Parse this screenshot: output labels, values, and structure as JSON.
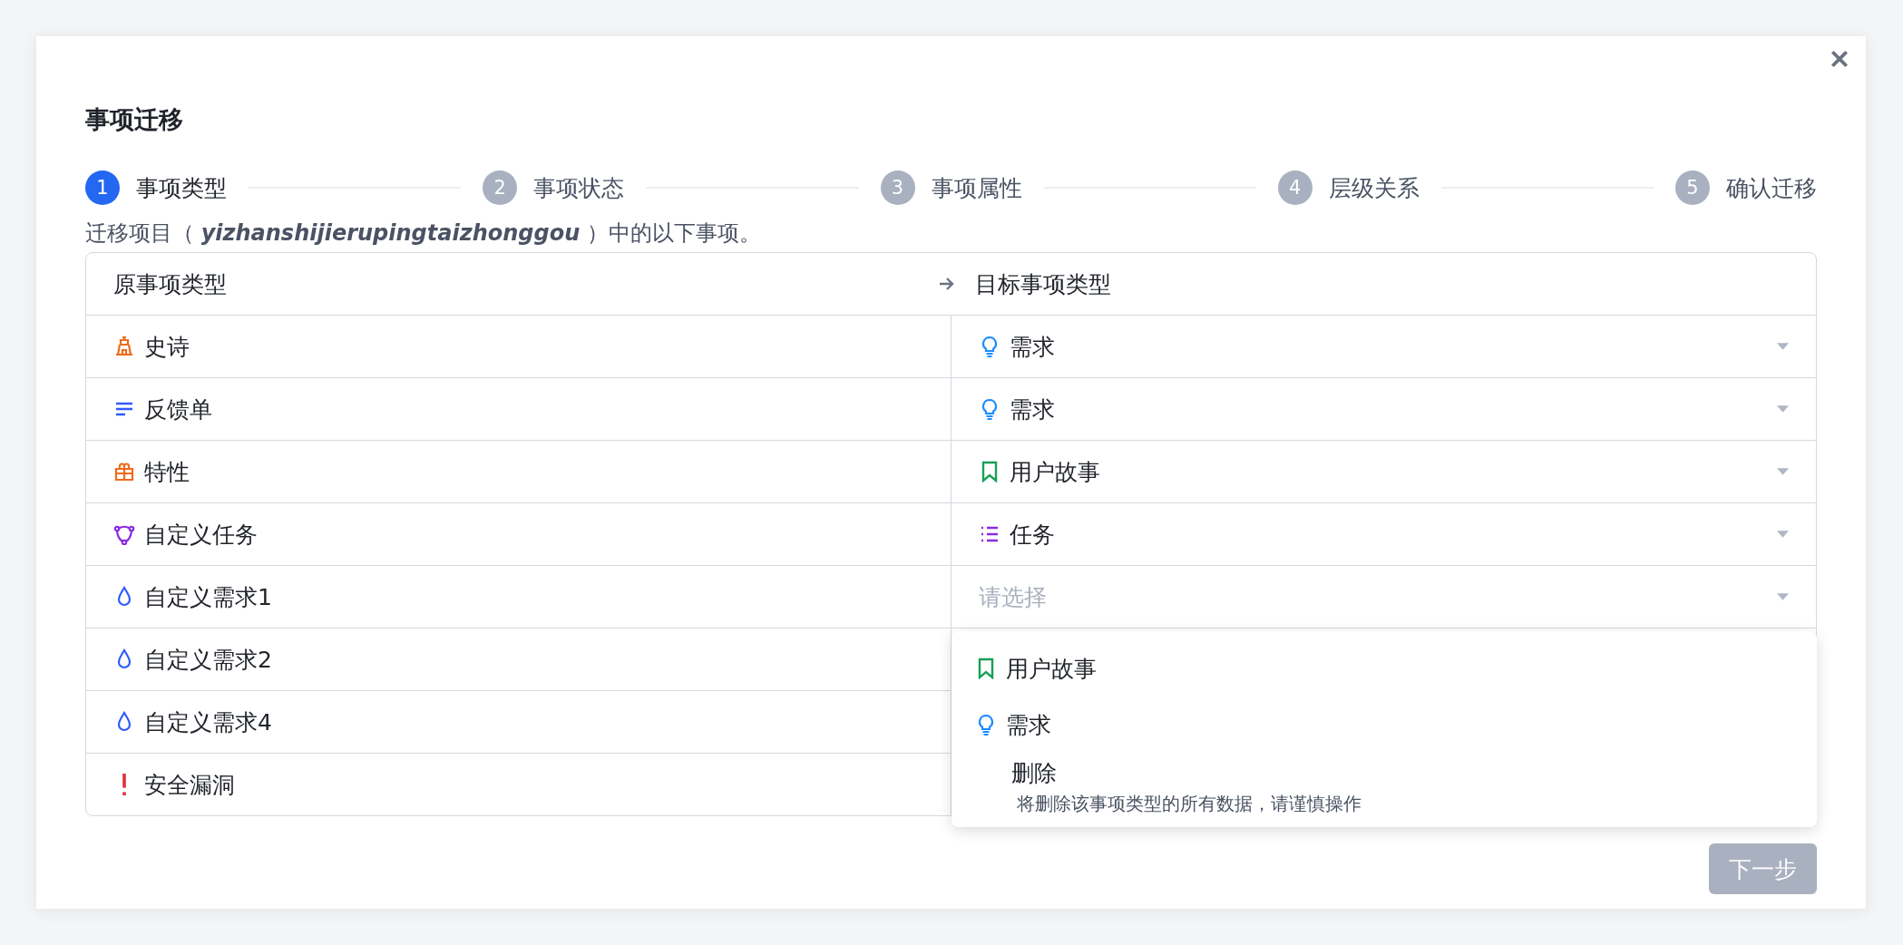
{
  "dialog": {
    "title": "事项迁移"
  },
  "steps": [
    {
      "number": "1",
      "label": "事项类型",
      "selected": true
    },
    {
      "number": "2",
      "label": "事项状态",
      "selected": false
    },
    {
      "number": "3",
      "label": "事项属性",
      "selected": false
    },
    {
      "number": "4",
      "label": "层级关系",
      "selected": false
    },
    {
      "number": "5",
      "label": "确认迁移",
      "selected": false
    }
  ],
  "description": "迁移项目（ *yizhanshijierupingtaizhonggou* ）中的以下事项。",
  "table": {
    "columns": [
      "原事项类型",
      "目标事项类型"
    ],
    "rows": [
      {
        "source": {
          "kind": "epic",
          "label": "史诗"
        },
        "target": {
          "kind": "requirement",
          "label": "需求"
        }
      },
      {
        "source": {
          "kind": "feedback",
          "label": "反馈单"
        },
        "target": {
          "kind": "requirement",
          "label": "需求"
        }
      },
      {
        "source": {
          "kind": "feature",
          "label": "特性"
        },
        "target": {
          "kind": "story",
          "label": "用户故事"
        }
      },
      {
        "source": {
          "kind": "custom-task",
          "label": "自定义任务"
        },
        "target": {
          "kind": "task",
          "label": "任务"
        }
      },
      {
        "source": {
          "kind": "custom-requirement",
          "label": "自定义需求1"
        },
        "target": {
          "placeholder": "请选择",
          "open": true
        }
      },
      {
        "source": {
          "kind": "custom-requirement",
          "label": "自定义需求2"
        }
      },
      {
        "source": {
          "kind": "custom-requirement",
          "label": "自定义需求4"
        }
      },
      {
        "source": {
          "kind": "bug",
          "label": "安全漏洞"
        }
      }
    ]
  },
  "dropdown": {
    "options": [
      {
        "kind": "story",
        "label": "用户故事"
      },
      {
        "kind": "requirement",
        "label": "需求"
      },
      {
        "kind": "delete",
        "label": "删除",
        "description": "将删除该事项类型的所有数据，请谨慎操作"
      }
    ]
  },
  "next_button": {
    "label": "下一步",
    "disabled": true
  }
}
